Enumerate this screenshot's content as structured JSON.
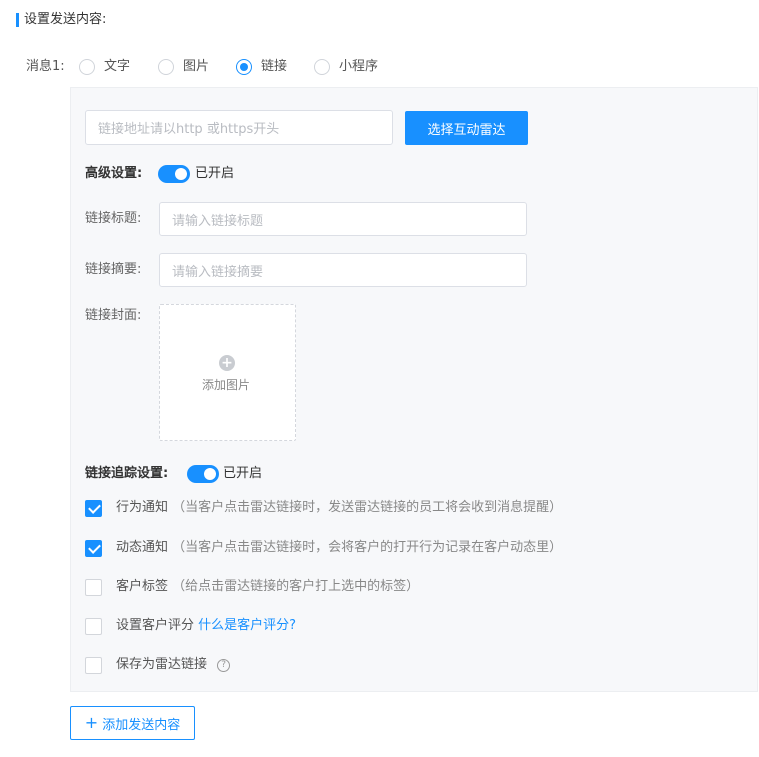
{
  "section": {
    "title": "设置发送内容:"
  },
  "message": {
    "label": "消息1:",
    "types": [
      {
        "label": "文字",
        "selected": false
      },
      {
        "label": "图片",
        "selected": false
      },
      {
        "label": "链接",
        "selected": true
      },
      {
        "label": "小程序",
        "selected": false
      }
    ]
  },
  "link": {
    "url_placeholder": "链接地址请以http 或https开头",
    "radar_button": "选择互动雷达"
  },
  "advanced": {
    "label": "高级设置:",
    "enabled": true,
    "status": "已开启",
    "title_label": "链接标题:",
    "title_placeholder": "请输入链接标题",
    "summary_label": "链接摘要:",
    "summary_placeholder": "请输入链接摘要",
    "cover_label": "链接封面:",
    "upload_text": "添加图片"
  },
  "tracking": {
    "label": "链接追踪设置:",
    "enabled": true,
    "status": "已开启",
    "options": [
      {
        "label": "行为通知",
        "note": "（当客户点击雷达链接时，发送雷达链接的员工将会收到消息提醒）",
        "checked": true
      },
      {
        "label": "动态通知",
        "note": "（当客户点击雷达链接时，会将客户的打开行为记录在客户动态里）",
        "checked": true
      },
      {
        "label": "客户标签",
        "note": "（给点击雷达链接的客户打上选中的标签）",
        "checked": false
      },
      {
        "label": "设置客户评分",
        "link": "什么是客户评分?",
        "checked": false
      },
      {
        "label": "保存为雷达链接",
        "help_icon": "question-circle-icon",
        "checked": false
      }
    ]
  },
  "add_button": {
    "icon": "plus-icon",
    "label": "添加发送内容"
  },
  "colors": {
    "primary": "#1890ff",
    "panel_bg": "#f7f8fa"
  }
}
